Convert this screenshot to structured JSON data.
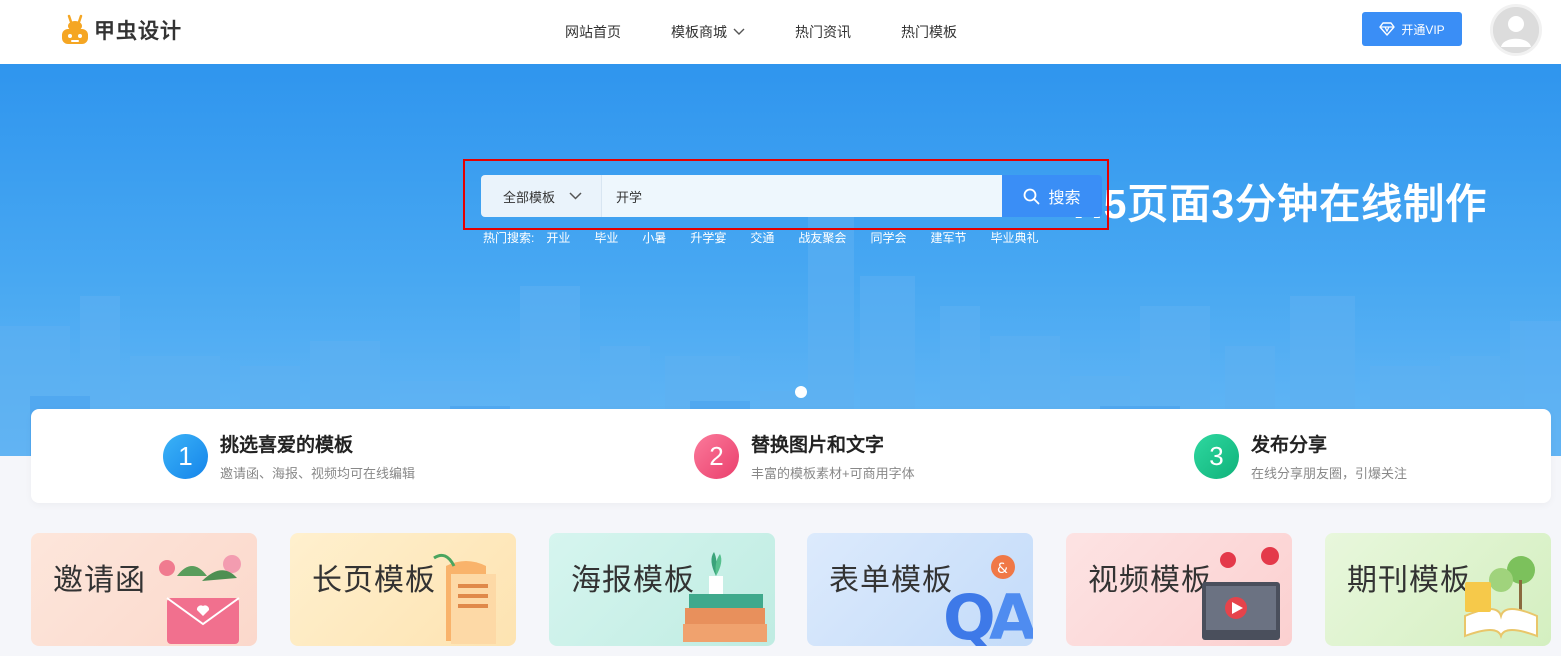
{
  "header": {
    "logo_text": "甲虫设计",
    "nav": [
      {
        "label": "网站首页"
      },
      {
        "label": "模板商城"
      },
      {
        "label": "热门资讯"
      },
      {
        "label": "热门模板"
      }
    ],
    "vip_label": "开通VIP"
  },
  "hero": {
    "title": "H5页面3分钟在线制作",
    "search": {
      "category": "全部模板",
      "value": "开学",
      "button": "搜索"
    },
    "hot_label": "热门搜索:",
    "hot_items": [
      "开业",
      "毕业",
      "小暑",
      "升学宴",
      "交通",
      "战友聚会",
      "同学会",
      "建军节",
      "毕业典礼"
    ]
  },
  "steps": [
    {
      "num": "1",
      "title": "挑选喜爱的模板",
      "desc": "邀请函、海报、视频均可在线编辑",
      "color": "#1e9bf0"
    },
    {
      "num": "2",
      "title": "替换图片和文字",
      "desc": "丰富的模板素材+可商用字体",
      "color": "#f0507a"
    },
    {
      "num": "3",
      "title": "发布分享",
      "desc": "在线分享朋友圈，引爆关注",
      "color": "#16c28a"
    }
  ],
  "categories": [
    {
      "label": "邀请函",
      "bg": "#fde1d6"
    },
    {
      "label": "长页模板",
      "bg": "#fde9c4"
    },
    {
      "label": "海报模板",
      "bg": "#cdf1ea"
    },
    {
      "label": "表单模板",
      "bg": "#d4e6fb"
    },
    {
      "label": "视频模板",
      "bg": "#fddcdc"
    },
    {
      "label": "期刊模板",
      "bg": "#e1f4d3"
    }
  ],
  "colors": {
    "accent": "#3a8ef6",
    "highlight": "#e50000"
  }
}
